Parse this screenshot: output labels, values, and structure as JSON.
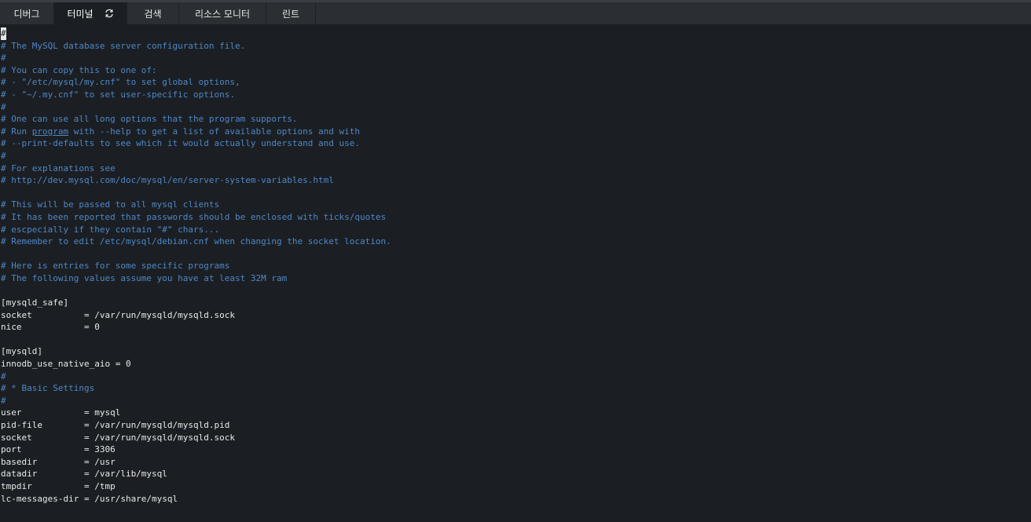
{
  "tabs": [
    {
      "label": "디버그",
      "active": false
    },
    {
      "label": "터미널",
      "active": true,
      "icon": "refresh-icon"
    },
    {
      "label": "검색",
      "active": false
    },
    {
      "label": "리소스 모니터",
      "active": false
    },
    {
      "label": "린트",
      "active": false
    }
  ],
  "terminal": {
    "cursor_char": "#",
    "lines": [
      {
        "text": "",
        "type": "cursor"
      },
      {
        "text": "# The MySQL database server configuration file.",
        "type": "comment"
      },
      {
        "text": "#",
        "type": "comment"
      },
      {
        "text": "# You can copy this to one of:",
        "type": "comment"
      },
      {
        "text": "# - \"/etc/mysql/my.cnf\" to set global options,",
        "type": "comment"
      },
      {
        "text": "# - \"~/.my.cnf\" to set user-specific options.",
        "type": "comment"
      },
      {
        "text": "#",
        "type": "comment"
      },
      {
        "text": "# One can use all long options that the program supports.",
        "type": "comment"
      },
      {
        "text": "# Run program with --help to get a list of available options and with",
        "type": "comment-underline",
        "pre": "# Run ",
        "underline": "program",
        "post": " with --help to get a list of available options and with"
      },
      {
        "text": "# --print-defaults to see which it would actually understand and use.",
        "type": "comment"
      },
      {
        "text": "#",
        "type": "comment"
      },
      {
        "text": "# For explanations see",
        "type": "comment"
      },
      {
        "text": "# http://dev.mysql.com/doc/mysql/en/server-system-variables.html",
        "type": "comment"
      },
      {
        "text": "",
        "type": "blank"
      },
      {
        "text": "# This will be passed to all mysql clients",
        "type": "comment"
      },
      {
        "text": "# It has been reported that passwords should be enclosed with ticks/quotes",
        "type": "comment"
      },
      {
        "text": "# escpecially if they contain \"#\" chars...",
        "type": "comment"
      },
      {
        "text": "# Remember to edit /etc/mysql/debian.cnf when changing the socket location.",
        "type": "comment"
      },
      {
        "text": "",
        "type": "blank"
      },
      {
        "text": "# Here is entries for some specific programs",
        "type": "comment"
      },
      {
        "text": "# The following values assume you have at least 32M ram",
        "type": "comment"
      },
      {
        "text": "",
        "type": "blank"
      },
      {
        "text": "[mysqld_safe]",
        "type": "plain"
      },
      {
        "text": "socket          = /var/run/mysqld/mysqld.sock",
        "type": "plain"
      },
      {
        "text": "nice            = 0",
        "type": "plain"
      },
      {
        "text": "",
        "type": "blank"
      },
      {
        "text": "[mysqld]",
        "type": "plain"
      },
      {
        "text": "innodb_use_native_aio = 0",
        "type": "plain"
      },
      {
        "text": "#",
        "type": "comment"
      },
      {
        "text": "# * Basic Settings",
        "type": "comment"
      },
      {
        "text": "#",
        "type": "comment"
      },
      {
        "text": "user            = mysql",
        "type": "plain"
      },
      {
        "text": "pid-file        = /var/run/mysqld/mysqld.pid",
        "type": "plain"
      },
      {
        "text": "socket          = /var/run/mysqld/mysqld.sock",
        "type": "plain"
      },
      {
        "text": "port            = 3306",
        "type": "plain"
      },
      {
        "text": "basedir         = /usr",
        "type": "plain"
      },
      {
        "text": "datadir         = /var/lib/mysql",
        "type": "plain"
      },
      {
        "text": "tmpdir          = /tmp",
        "type": "plain"
      },
      {
        "text": "lc-messages-dir = /usr/share/mysql",
        "type": "plain"
      }
    ]
  },
  "colors": {
    "comment": "#4f86c6",
    "plain": "#e8e8e8",
    "background": "#1b1f23",
    "tabbar": "#2b2f33"
  }
}
